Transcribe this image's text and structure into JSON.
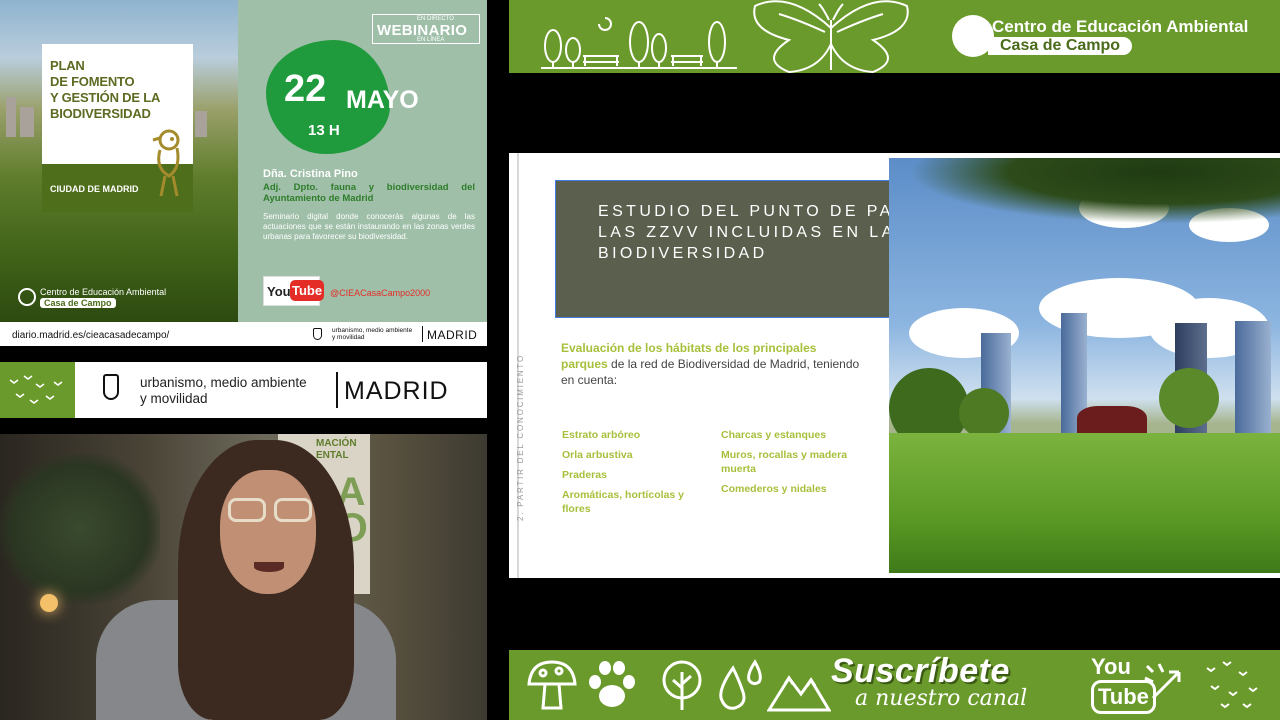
{
  "poster": {
    "title_lines": [
      "PLAN",
      "DE FOMENTO",
      "Y GESTIÓN DE LA",
      "BIODIVERSIDAD"
    ],
    "city_label": "CIUDAD DE MADRID",
    "webinar_top": "EN DIRECTO",
    "webinar_label": "WEBINARIO",
    "webinar_bottom": "EN LÍNEA",
    "day": "22",
    "month": "MAYO",
    "hour": "13 H",
    "speaker": "Dña. Cristina Pino",
    "speaker_role": "Adj. Dpto. fauna y biodiversidad del Ayuntamiento de Madrid",
    "seminar_text": "Seminario digital donde conocerás algunas de las actuaciones que se están instaurando en las zonas verdes urbanas para favorecer su biodiversidad.",
    "youtube_you": "You",
    "youtube_tube": "Tube",
    "youtube_handle": "@CIEACasaCampo2000",
    "logo_line1": "Centro de Educación Ambiental",
    "logo_line2": "Casa de Campo",
    "url": "diario.madrid.es/cieacasadecampo/",
    "footer_dept": "urbanismo, medio ambiente\ny movilidad",
    "footer_city": "MADRID"
  },
  "madrid_bar": {
    "dept_line1": "urbanismo, medio ambiente",
    "dept_line2": "y movilidad",
    "city": "MADRID"
  },
  "webcam": {
    "banner_text": "MACIÓN\nENTAL",
    "banner_big": "SA\nPO"
  },
  "top_banner": {
    "line1": "Centro de Educación Ambiental",
    "line2": "Casa de Campo"
  },
  "slide": {
    "side_label": "2. PARTIR DEL CONOCIMIENTO",
    "title": "ESTUDIO DEL PUNTO DE PARTIDA DE LAS ZZVV INCLUIDAS EN LA RED DE BIODIVERSIDAD",
    "intro_highlight": "Evaluación de los hábitats de los principales parques",
    "intro_rest": " de la red de Biodiversidad de Madrid, teniendo en cuenta:",
    "list_left": [
      "Estrato arbóreo",
      "Orla arbustiva",
      "Praderas",
      "Aromáticas, hortícolas y flores"
    ],
    "list_right": [
      "Charcas y estanques",
      "Muros, rocallas y madera muerta",
      "Comederos y nidales"
    ]
  },
  "bottom_banner": {
    "subscribe": "Suscríbete",
    "channel": "a nuestro canal",
    "yt_you": "You",
    "yt_tube": "Tube",
    "icons": [
      "mushroom-icon",
      "paw-print-icon",
      "tree-icon",
      "water-drops-icon",
      "mountains-icon"
    ]
  },
  "colors": {
    "brand_green": "#6a9a2b",
    "poster_teal": "#9fbfa9",
    "blob_green": "#1f9a3c",
    "slide_title_bg": "#5b5f4e",
    "slide_accent": "#a7c03c",
    "youtube_red": "#e52d27"
  }
}
